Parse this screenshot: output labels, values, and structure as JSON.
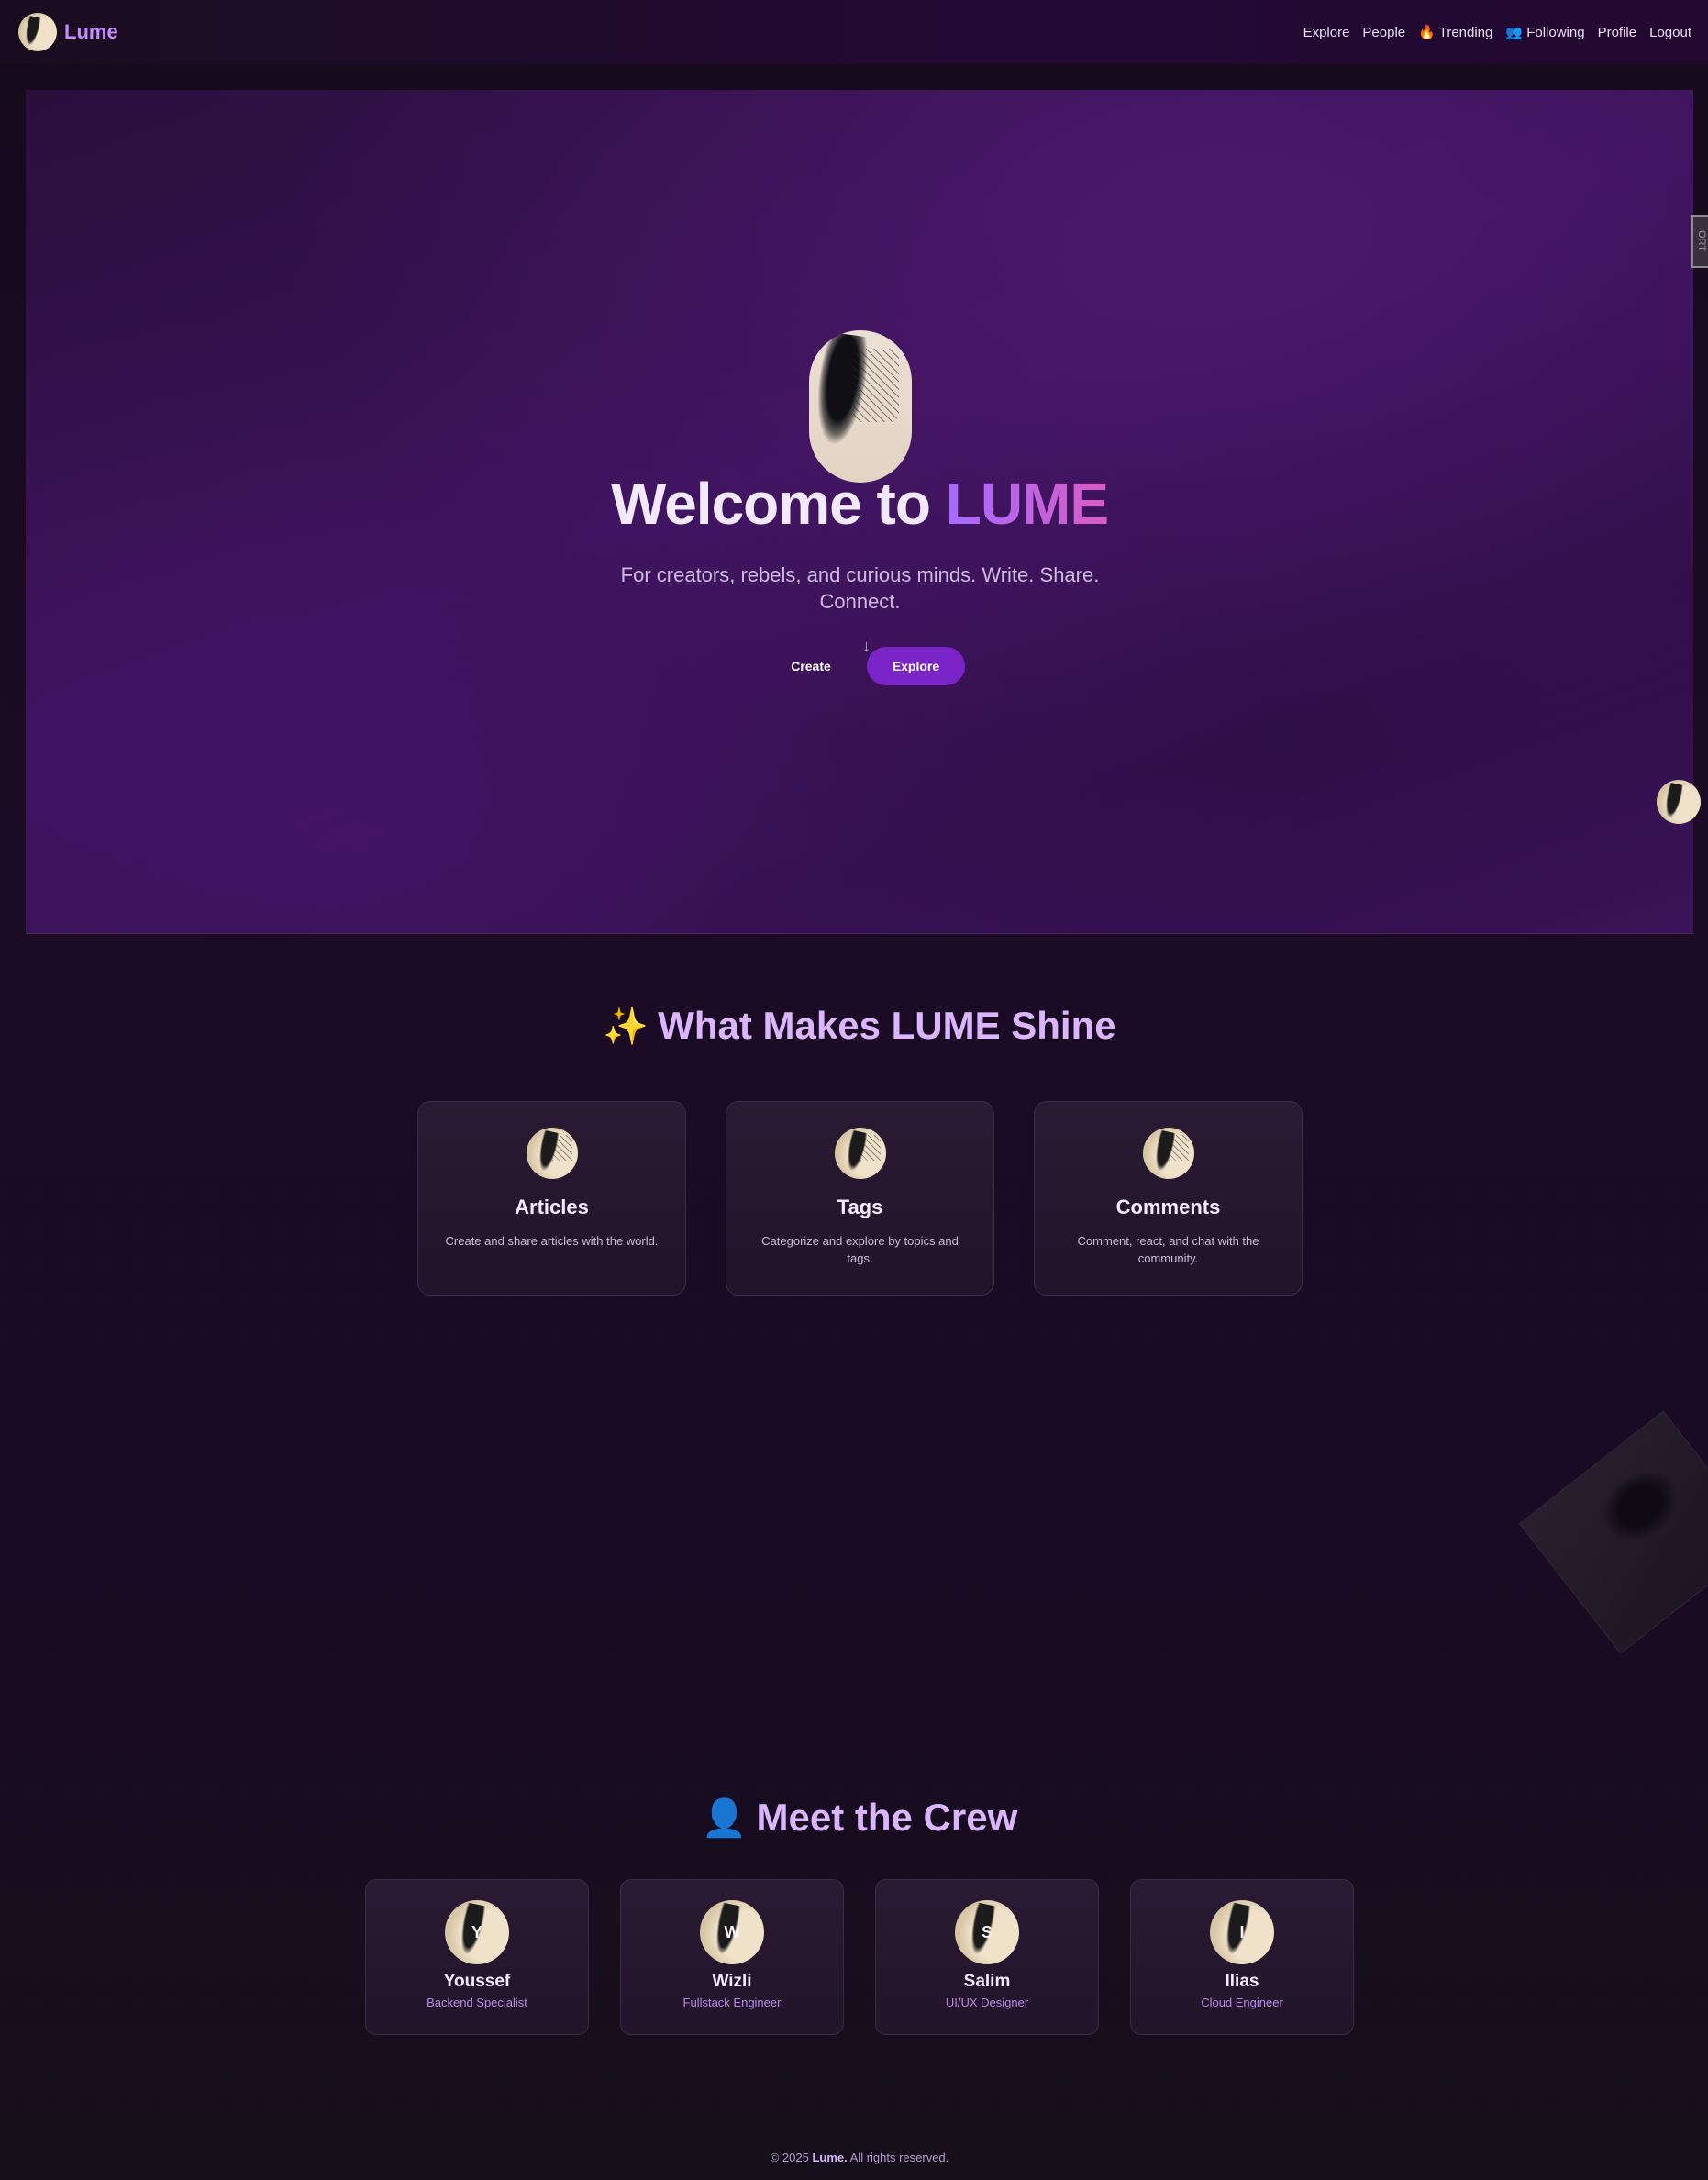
{
  "nav": {
    "brand": "Lume",
    "links": [
      "Explore",
      "People",
      "🔥 Trending",
      "👥 Following",
      "Profile",
      "Logout"
    ]
  },
  "hero": {
    "title_prefix": "Welcome to ",
    "title_accent": "LUME",
    "subtitle": "For creators, rebels, and curious minds. Write. Share. Connect.",
    "create_label": "Create",
    "explore_label": "Explore",
    "side_tab": "ORT"
  },
  "features": {
    "icon": "✨",
    "title": "What Makes LUME Shine",
    "cards": [
      {
        "title": "Articles",
        "desc": "Create and share articles with the world."
      },
      {
        "title": "Tags",
        "desc": "Categorize and explore by topics and tags."
      },
      {
        "title": "Comments",
        "desc": "Comment, react, and chat with the community."
      }
    ]
  },
  "crew": {
    "icon": "👤",
    "title": "Meet the Crew",
    "members": [
      {
        "initial": "Y",
        "name": "Youssef",
        "role": "Backend Specialist"
      },
      {
        "initial": "W",
        "name": "Wizli",
        "role": "Fullstack Engineer"
      },
      {
        "initial": "S",
        "name": "Salim",
        "role": "UI/UX Designer"
      },
      {
        "initial": "I",
        "name": "Ilias",
        "role": "Cloud Engineer"
      }
    ]
  },
  "footer": {
    "prefix": "© 2025 ",
    "brand": "Lume.",
    "suffix": " All rights reserved."
  },
  "colors": {
    "accent": "#7b25c9",
    "brand": "#c58cff",
    "heading": "#dcb5ff",
    "role": "#b68ae6"
  }
}
